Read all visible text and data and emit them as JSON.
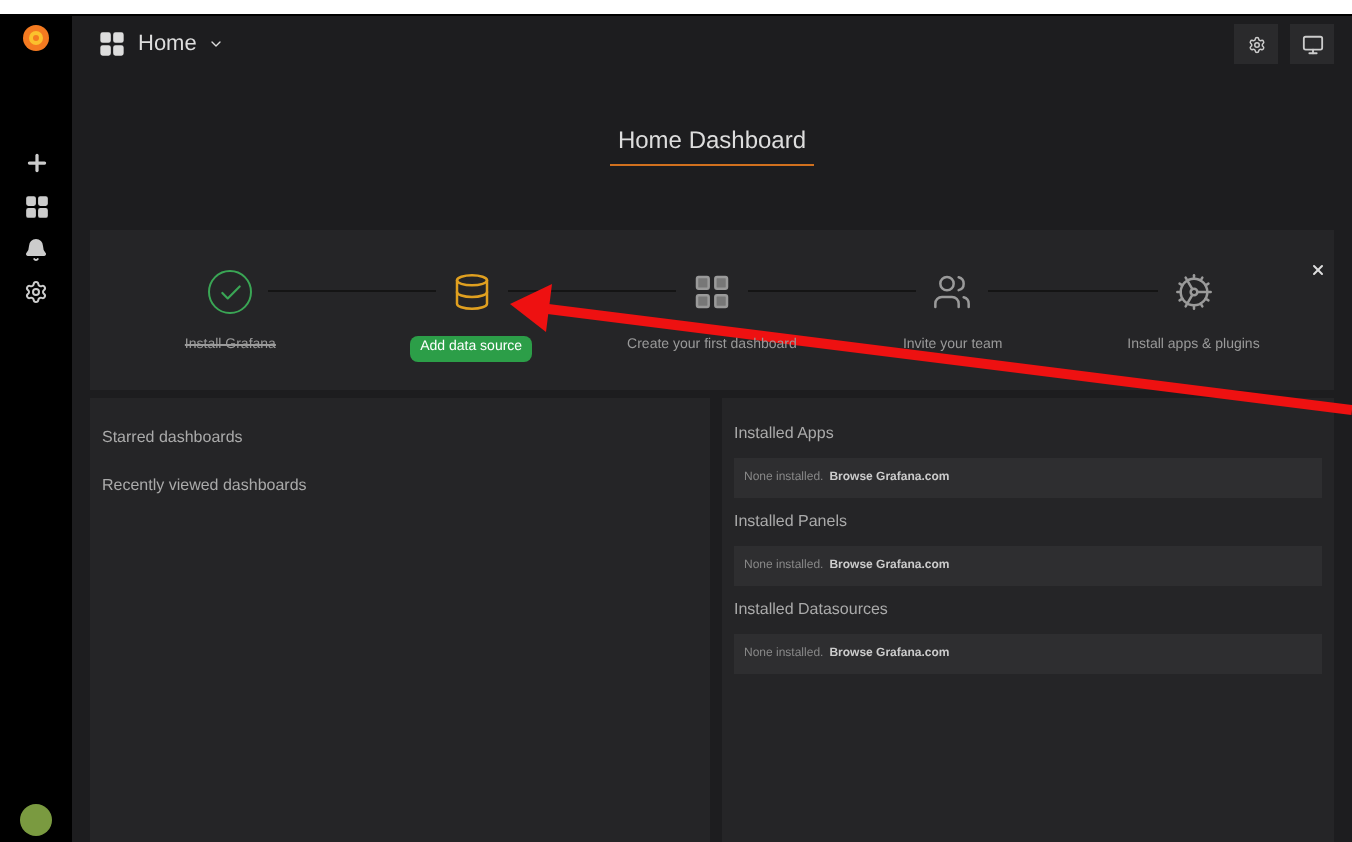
{
  "topbar": {
    "title": "Home"
  },
  "header": {
    "title": "Home Dashboard"
  },
  "steps": [
    {
      "label": "Install Grafana",
      "kind": "done"
    },
    {
      "label": "Add data source",
      "kind": "active"
    },
    {
      "label": "Create your first dashboard",
      "kind": "todo"
    },
    {
      "label": "Invite your team",
      "kind": "todo"
    },
    {
      "label": "Install apps & plugins",
      "kind": "todo"
    }
  ],
  "left_panel": {
    "links": [
      "Starred dashboards",
      "Recently viewed dashboards"
    ]
  },
  "right_panel": {
    "sections": [
      {
        "title": "Installed Apps",
        "note": "None installed.",
        "link": "Browse Grafana.com"
      },
      {
        "title": "Installed Panels",
        "note": "None installed.",
        "link": "Browse Grafana.com"
      },
      {
        "title": "Installed Datasources",
        "note": "None installed.",
        "link": "Browse Grafana.com"
      }
    ]
  }
}
